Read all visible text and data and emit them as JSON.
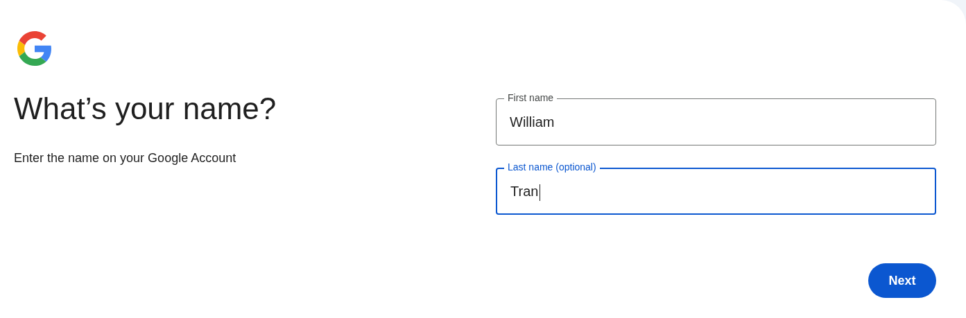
{
  "heading": "What’s your name?",
  "subtitle": "Enter the name on your Google Account",
  "fields": [
    {
      "label": "First name",
      "value": "William",
      "focused": false
    },
    {
      "label": "Last name (optional)",
      "value": "Tran",
      "focused": true
    }
  ],
  "next_button": "Next"
}
